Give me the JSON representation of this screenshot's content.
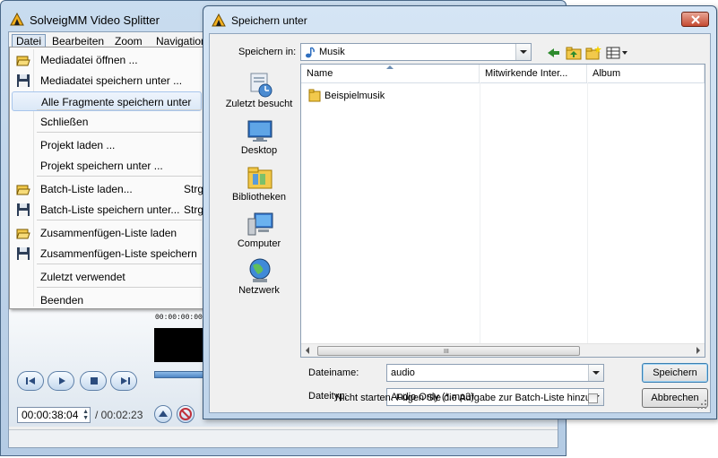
{
  "app": {
    "title": "SolveigMM Video Splitter",
    "menubar": [
      "Datei",
      "Bearbeiten",
      "Zoom",
      "Navigation"
    ],
    "time_current": "00:00:38:04",
    "time_total": "/ 00:02:23",
    "timeline_label": "00:00:00:00"
  },
  "file_menu": {
    "items": [
      {
        "label": "Mediadatei öffnen ...",
        "icon": "open-folder-icon",
        "shortcut": ""
      },
      {
        "label": "Mediadatei speichern unter ...",
        "icon": "floppy-disk-icon",
        "shortcut": ""
      },
      {
        "label": "Alle Fragmente speichern unter ...",
        "icon": "",
        "shortcut": ""
      },
      {
        "label": "Schließen",
        "icon": "",
        "shortcut": ""
      },
      {
        "label": "Projekt laden ...",
        "icon": "",
        "shortcut": ""
      },
      {
        "label": "Projekt speichern unter ...",
        "icon": "",
        "shortcut": ""
      },
      {
        "label": "Batch-Liste laden...",
        "icon": "open-folder-icon",
        "shortcut": "Strg"
      },
      {
        "label": "Batch-Liste speichern unter...",
        "icon": "floppy-disk-icon",
        "shortcut": "Strg"
      },
      {
        "label": "Zusammenfügen-Liste laden",
        "icon": "open-folder-icon",
        "shortcut": ""
      },
      {
        "label": "Zusammenfügen-Liste speichern",
        "icon": "floppy-disk-icon",
        "shortcut": ""
      },
      {
        "label": "Zuletzt verwendet",
        "icon": "",
        "shortcut": ""
      },
      {
        "label": "Beenden",
        "icon": "",
        "shortcut": ""
      }
    ]
  },
  "dialog": {
    "title": "Speichern unter",
    "save_in_label": "Speichern in:",
    "save_in_value": "Musik",
    "places": [
      "Zuletzt besucht",
      "Desktop",
      "Bibliotheken",
      "Computer",
      "Netzwerk"
    ],
    "columns": [
      "Name",
      "Mitwirkende Inter...",
      "Album"
    ],
    "files": [
      {
        "name": "Beispielmusik",
        "icon": "folder-icon"
      }
    ],
    "scroll_grip": "III",
    "filename_label": "Dateiname:",
    "filename_value": "audio",
    "filetype_label": "Dateityp:",
    "filetype_value": "Audio Only (*.mp3)",
    "save_button": "Speichern",
    "cancel_button": "Abbrechen",
    "checkbox_label": "Nicht starten. Fügen Sie die Aufgabe zur Batch-Liste hinzu."
  },
  "colors": {
    "menu_highlight": "#dbe8f7",
    "title_gradient": "#d5e5f5",
    "close_button": "#c54a31",
    "folder": "#f2c94c"
  }
}
